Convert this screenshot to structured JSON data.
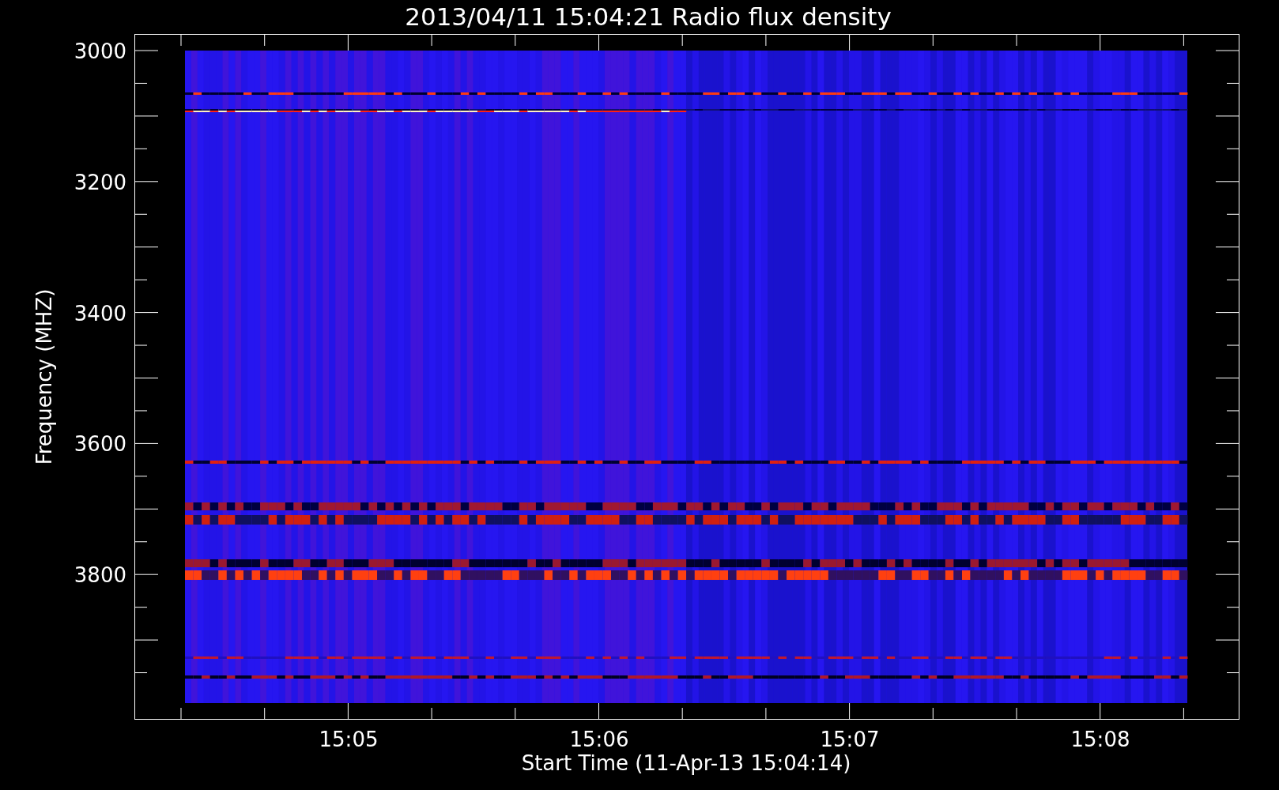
{
  "title": "2013/04/11 15:04:21 Radio flux density",
  "y_axis": {
    "label": "Frequency (MHZ)",
    "ticks": [
      "3000",
      "3200",
      "3400",
      "3600",
      "3800"
    ]
  },
  "x_axis": {
    "label": "Start Time (11-Apr-13 15:04:14)",
    "ticks": [
      "15:05",
      "15:06",
      "15:07",
      "15:08"
    ]
  }
}
